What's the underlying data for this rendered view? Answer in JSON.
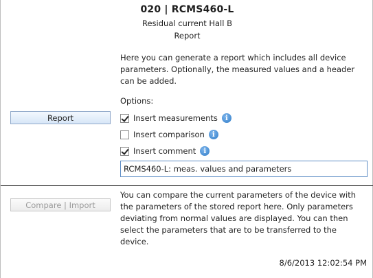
{
  "header": {
    "title": "020 | RCMS460-L",
    "subtitle": "Residual current Hall B",
    "section": "Report"
  },
  "report": {
    "description": "Here you can generate a report which includes all device parameters. Optionally, the measured values and a header can be added.",
    "options_label": "Options:",
    "button_label": "Report",
    "options": [
      {
        "label": "Insert measurements",
        "checked": true
      },
      {
        "label": "Insert comparison",
        "checked": false
      },
      {
        "label": "Insert comment",
        "checked": true
      }
    ],
    "comment_value": "RCMS460-L: meas. values and parameters"
  },
  "compare": {
    "description": "You can compare the current parameters of the device with the parameters of the stored report here. Only parameters deviating from normal values are displayed. You can then select the parameters that are to be transferred to the device.",
    "button_label": "Compare | Import",
    "enabled": false
  },
  "footer": {
    "timestamp": "8/6/2013 12:02:54 PM"
  },
  "icons": {
    "info": "info-icon",
    "checkbox": "checkbox-icon"
  }
}
